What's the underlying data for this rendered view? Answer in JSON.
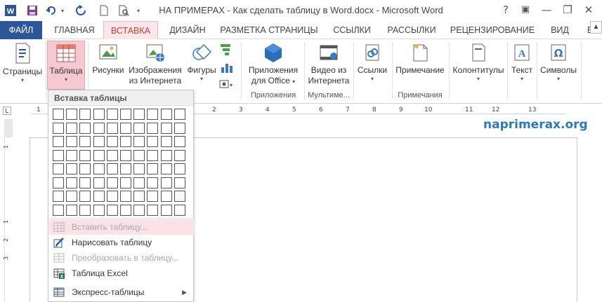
{
  "window": {
    "title": "НА ПРИМЕРАХ - Как сделать таблицу в Word.docx - Microsoft Word",
    "controls": [
      "?",
      "▣",
      "—",
      "❐",
      "✕"
    ]
  },
  "tabs": [
    "ФАЙЛ",
    "ГЛАВНАЯ",
    "ВСТАВКА",
    "ДИЗАЙН",
    "РАЗМЕТКА СТРАНИЦЫ",
    "ССЫЛКИ",
    "РАССЫЛКИ",
    "РЕЦЕНЗИРОВАНИЕ",
    "ВИД",
    "Е"
  ],
  "ribbon": {
    "pages": "Страницы",
    "table": "Таблица",
    "pictures": "Рисунки",
    "online_pictures_1": "Изображения",
    "online_pictures_2": "из Интернета",
    "shapes": "Фигуры",
    "apps_1": "Приложения",
    "apps_2": "для Office",
    "video_1": "Видео из",
    "video_2": "Интернета",
    "links": "Ссылки",
    "comment": "Примечание",
    "header_footer": "Колонтитулы",
    "text": "Текст",
    "symbols": "Символы",
    "group_apps": "Приложения",
    "group_media": "Мультиме...",
    "group_comments": "Примечания"
  },
  "ruler": {
    "h_numbers": [
      "1",
      "1",
      "2",
      "3",
      "4",
      "5",
      "6",
      "7",
      "8",
      "9",
      "10",
      "11",
      "12",
      "13"
    ],
    "v_numbers": [
      "1",
      "1",
      "2",
      "3"
    ]
  },
  "watermark": "naprimerax.org",
  "dropdown": {
    "header": "Вставка таблицы",
    "grid_cols": 10,
    "grid_rows": 8,
    "items": [
      {
        "label": "Вставить таблицу...",
        "icon": "table-insert-icon",
        "disabled": true,
        "highlight": true
      },
      {
        "label": "Нарисовать таблицу",
        "icon": "pencil-table-icon",
        "disabled": false,
        "highlight": false
      },
      {
        "label": "Преобразовать в таблицу...",
        "icon": "convert-table-icon",
        "disabled": true,
        "highlight": false
      },
      {
        "label": "Таблица Excel",
        "icon": "excel-table-icon",
        "disabled": false,
        "highlight": false
      },
      {
        "label": "Экспресс-таблицы",
        "icon": "quick-tables-icon",
        "disabled": false,
        "highlight": false,
        "submenu": true
      }
    ]
  },
  "colors": {
    "file_tab": "#2b579a",
    "insert_tab_text": "#c5432f",
    "insert_tab_bg": "#fbe6ec",
    "watermark": "#2a7ab8"
  }
}
